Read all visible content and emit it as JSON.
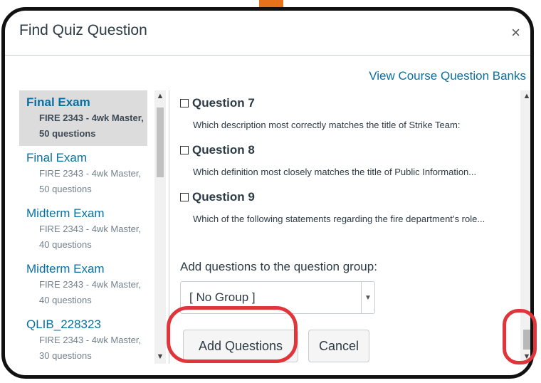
{
  "dialog": {
    "title": "Find Quiz Question",
    "close_label": "×",
    "bank_link": "View Course Question Banks"
  },
  "banks": [
    {
      "name": "Final Exam",
      "course": "FIRE 2343 - 4wk Master,",
      "count": "50 questions",
      "selected": true
    },
    {
      "name": "Final Exam",
      "course": "FIRE 2343 - 4wk Master,",
      "count": "50 questions",
      "selected": false
    },
    {
      "name": "Midterm Exam",
      "course": "FIRE 2343 - 4wk Master,",
      "count": "40 questions",
      "selected": false
    },
    {
      "name": "Midterm Exam",
      "course": "FIRE 2343 - 4wk Master,",
      "count": "40 questions",
      "selected": false
    },
    {
      "name": "QLIB_228323",
      "course": "FIRE 2343 - 4wk Master,",
      "count": "30 questions",
      "selected": false
    }
  ],
  "questions": [
    {
      "title": "Question 7",
      "text": "Which description most correctly matches the title of Strike Team:"
    },
    {
      "title": "Question 8",
      "text": "Which definition most closely matches the title of Public Information..."
    },
    {
      "title": "Question 9",
      "text": "Which of the following statements regarding the fire department’s role..."
    }
  ],
  "group": {
    "label": "Add questions to the question group:",
    "selected": "[ No Group ]"
  },
  "buttons": {
    "add": "Add Questions",
    "cancel": "Cancel"
  },
  "icons": {
    "scroll_up": "▲",
    "scroll_down": "▼",
    "caret": "⌄"
  },
  "colors": {
    "link": "#0770a3",
    "annotation": "#e0363b",
    "orange": "#e8721c"
  }
}
